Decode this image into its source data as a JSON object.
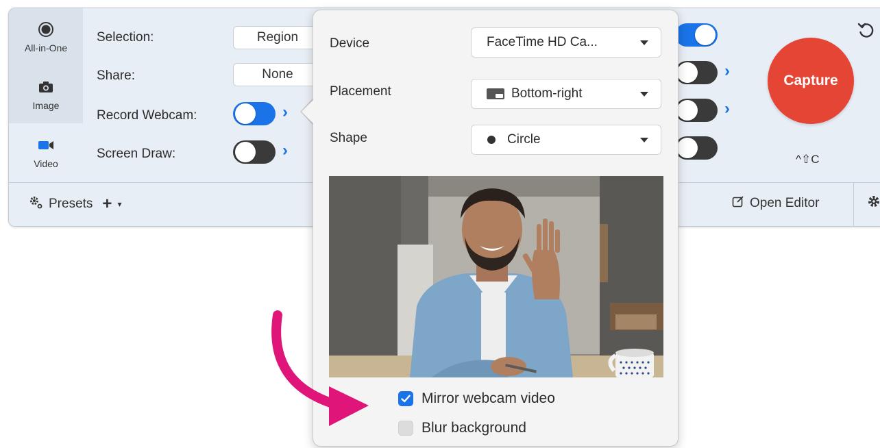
{
  "modes": [
    {
      "label": "All-in-One",
      "icon": "record-dot-icon"
    },
    {
      "label": "Image",
      "icon": "camera-icon"
    },
    {
      "label": "Video",
      "icon": "video-camera-icon",
      "selected": true
    }
  ],
  "settings": {
    "selection_label": "Selection:",
    "selection_value": "Region",
    "share_label": "Share:",
    "share_value": "None",
    "record_webcam_label": "Record Webcam:",
    "record_webcam_on": true,
    "screen_draw_label": "Screen Draw:",
    "screen_draw_on": false
  },
  "capture": {
    "label": "Capture",
    "shortcut": "^⇧C"
  },
  "bottom_bar": {
    "presets_label": "Presets",
    "add_symbol": "+",
    "open_editor_label": "Open Editor"
  },
  "webcam_popover": {
    "device_label": "Device",
    "device_value": "FaceTime HD Ca...",
    "placement_label": "Placement",
    "placement_value": "Bottom-right",
    "shape_label": "Shape",
    "shape_value": "Circle",
    "mirror_label": "Mirror webcam video",
    "mirror_checked": true,
    "blur_label": "Blur background",
    "blur_checked": false
  },
  "colors": {
    "accent": "#1a73e8",
    "capture_red": "#e54534",
    "annotation_arrow": "#e0157a"
  }
}
